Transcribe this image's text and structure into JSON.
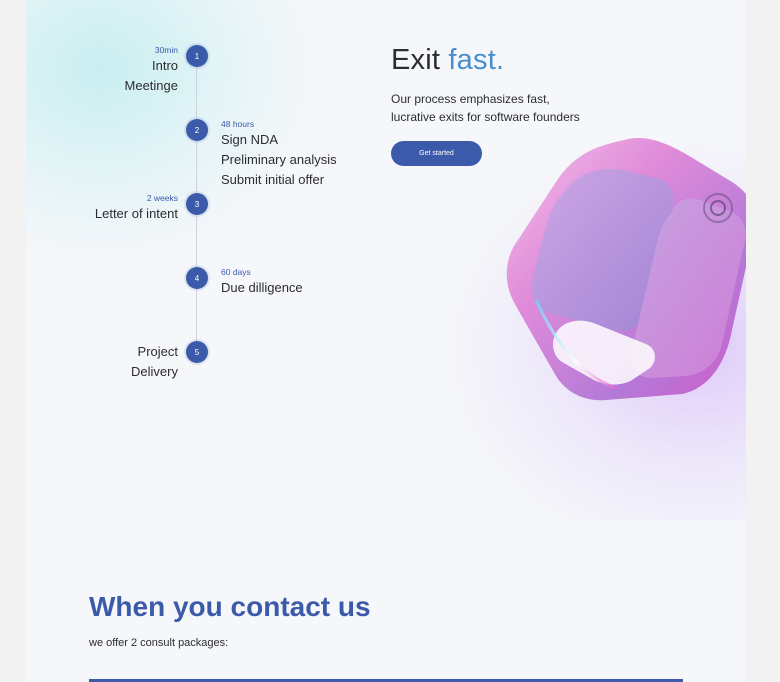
{
  "process": {
    "steps": [
      {
        "number": "1",
        "duration": "30min",
        "title": "Intro\nMeetinge"
      },
      {
        "number": "2",
        "duration": "48 hours",
        "title": "Sign NDA\nPreliminary analysis\nSubmit initial offer"
      },
      {
        "number": "3",
        "duration": "2 weeks",
        "title": "Letter of intent"
      },
      {
        "number": "4",
        "duration": "60 days",
        "title": "Due dilligence"
      },
      {
        "number": "5",
        "title": "Project\nDelivery"
      }
    ]
  },
  "hero": {
    "title_plain": "Exit ",
    "title_accent": "fast.",
    "subtitle": "Our process emphasizes fast,\nlucrative exits for software founders",
    "cta_label": "Get started",
    "image": "iridescent-3d-cube"
  },
  "contact": {
    "title": "When you contact us",
    "subtitle": "we offer 2 consult packages:"
  },
  "colors": {
    "brand_blue": "#3b5aa9",
    "accent_blue": "#4a8fcc",
    "text_dark": "#2c2d33"
  }
}
